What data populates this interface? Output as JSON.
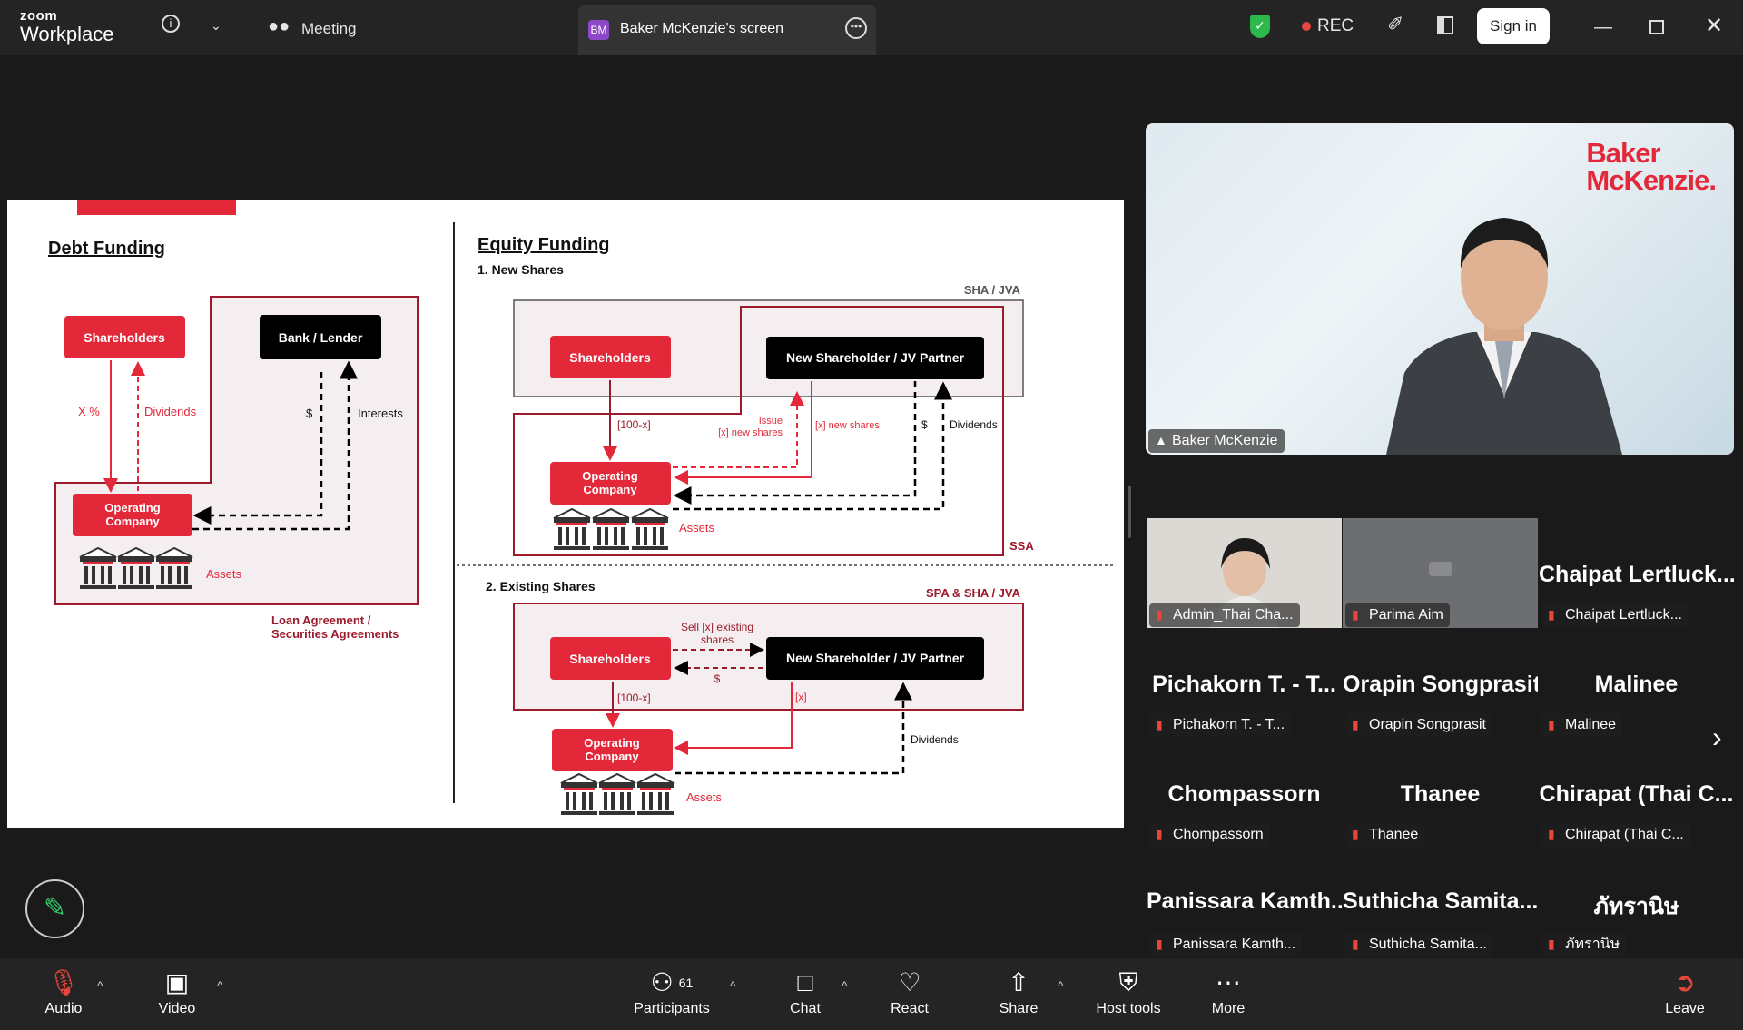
{
  "app": {
    "brand_top": "zoom",
    "brand_bottom": "Workplace"
  },
  "titlebar": {
    "meeting_label": "Meeting",
    "screen_tab_initials": "BM",
    "screen_tab_label": "Baker McKenzie's screen",
    "rec_label": "REC",
    "signin_label": "Sign in"
  },
  "slide": {
    "debt": {
      "heading": "Debt Funding",
      "shareholders": "Shareholders",
      "bank": "Bank / Lender",
      "xpct": "X %",
      "dividends": "Dividends",
      "dollar": "$",
      "interests": "Interests",
      "opco_1": "Operating",
      "opco_2": "Company",
      "assets": "Assets",
      "agreement_1": "Loan Agreement /",
      "agreement_2": "Securities Agreements"
    },
    "equity": {
      "heading": "Equity Funding",
      "new_title": "1. New Shares",
      "sha_jva": "SHA / JVA",
      "shareholders": "Shareholders",
      "new_shareholder": "New Shareholder / JV Partner",
      "hundred_x": "[100-x]",
      "issue_1": "Issue",
      "issue_2": "[x] new shares",
      "x_new_shares": "[x] new shares",
      "dollar": "$",
      "dividends": "Dividends",
      "opco_1": "Operating",
      "opco_2": "Company",
      "assets": "Assets",
      "ssa": "SSA",
      "existing_title": "2. Existing Shares",
      "spa_sha_jva": "SPA & SHA / JVA",
      "sell_1": "Sell [x] existing",
      "sell_2": "shares",
      "x_label": "[x]",
      "dividends_2": "Dividends"
    }
  },
  "speaker": {
    "logo_1": "Baker",
    "logo_2": "McKenzie.",
    "name": "Baker McKenzie"
  },
  "gallery": [
    {
      "big": "",
      "name": "Admin_Thai Cha..."
    },
    {
      "big": "",
      "name": "Parima Aim"
    },
    {
      "big": "Chaipat Lertluck...",
      "name": "Chaipat Lertluck..."
    },
    {
      "big": "Pichakorn T. - T...",
      "name": "Pichakorn T. - T..."
    },
    {
      "big": "Orapin Songprasit",
      "name": "Orapin Songprasit"
    },
    {
      "big": "Malinee",
      "name": "Malinee"
    },
    {
      "big": "Chompassorn",
      "name": "Chompassorn"
    },
    {
      "big": "Thanee",
      "name": "Thanee"
    },
    {
      "big": "Chirapat (Thai C...",
      "name": "Chirapat (Thai C..."
    },
    {
      "big": "Panissara Kamth...",
      "name": "Panissara Kamth..."
    },
    {
      "big": "Suthicha Samita...",
      "name": "Suthicha Samita..."
    },
    {
      "big": "ภัทรานิษ",
      "name": "ภัทรานิษ"
    }
  ],
  "toolbar": {
    "audio": "Audio",
    "video": "Video",
    "participants": "Participants",
    "participants_count": "61",
    "chat": "Chat",
    "react": "React",
    "share": "Share",
    "host_tools": "Host tools",
    "more": "More",
    "leave": "Leave"
  },
  "colors": {
    "accent_red": "#e3283a",
    "dark_red": "#9c1a2b",
    "rec_red": "#e8453c",
    "shield_green": "#2db84d"
  }
}
